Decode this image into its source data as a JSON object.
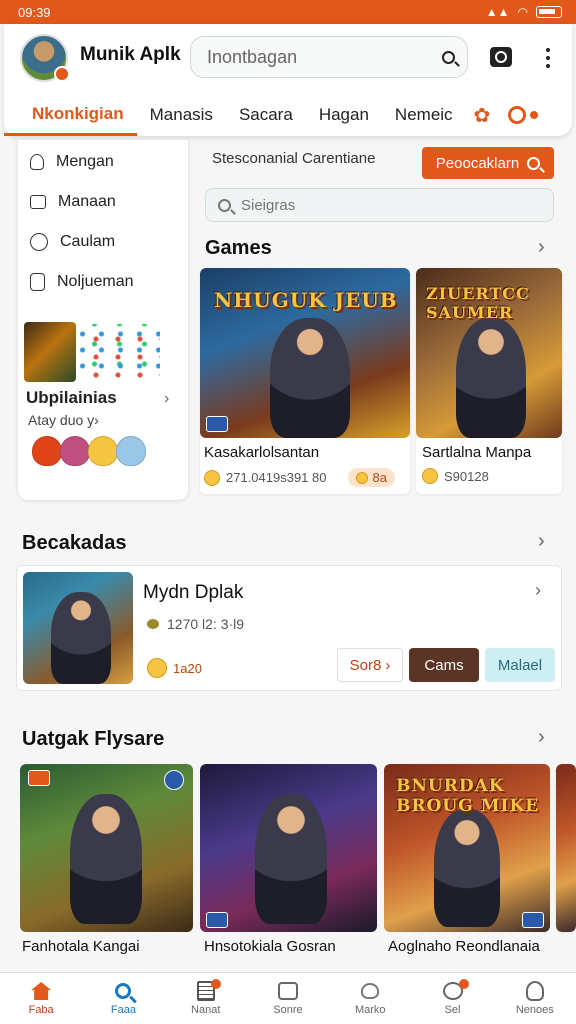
{
  "status_bar": {
    "time": "09:39"
  },
  "header": {
    "app_title": "Munik Aplk",
    "search_placeholder": "Inontbagan",
    "tabs": [
      {
        "label": "Nkonkigian",
        "active": true
      },
      {
        "label": "Manasis"
      },
      {
        "label": "Sacara"
      },
      {
        "label": "Hagan"
      },
      {
        "label": "Nemeic"
      }
    ]
  },
  "sidebar": {
    "items": [
      {
        "label": "Mengan",
        "icon": "person-icon"
      },
      {
        "label": "Manaan",
        "icon": "bag-icon"
      },
      {
        "label": "Caulam",
        "icon": "info-circle-icon"
      },
      {
        "label": "Noljueman",
        "icon": "phone-icon"
      }
    ],
    "promo": {
      "title": "Ubpilainias",
      "subtitle": "Atay duo y›"
    }
  },
  "content": {
    "header_text": "Stesconanial Carentiane",
    "promo_button": "Peoocaklarn",
    "search_placeholder": "Sieigras"
  },
  "games_section": {
    "title": "Games",
    "cards": [
      {
        "name": "Kasakarlolsantan",
        "meta": "271.0419s391 80",
        "pill": "8a",
        "logo": "NHUGUK JEUB"
      },
      {
        "name": "Sartlalna Manpa",
        "meta": "S90128",
        "logo": "ZIUERTCC SAUMER"
      }
    ]
  },
  "becakadas_section": {
    "title": "Becakadas",
    "item": {
      "title": "Mydn Dplak",
      "meta": "1270 l2: 3·l9",
      "rating": "1a20",
      "btn_outline": "Sor8",
      "btn_dark": "Cams",
      "btn_light": "Malael"
    }
  },
  "uatgak_section": {
    "title": "Uatgak Flysare",
    "cards": [
      {
        "name": "Fanhotala Kangai"
      },
      {
        "name": "Hnsotokiala Gosran"
      },
      {
        "name": "Aoglnaho Reondlanaia",
        "logo": "BNURDAK BROUG MIKE"
      }
    ]
  },
  "bottom_nav": [
    {
      "label": "Faba",
      "icon": "home-icon"
    },
    {
      "label": "Faaa",
      "icon": "search-icon"
    },
    {
      "label": "Nanat",
      "icon": "document-icon"
    },
    {
      "label": "Sonre",
      "icon": "chat-check-icon"
    },
    {
      "label": "Marko",
      "icon": "heart-icon"
    },
    {
      "label": "Sel",
      "icon": "sel-icon"
    },
    {
      "label": "Nenoes",
      "icon": "user-icon"
    }
  ],
  "colors": {
    "accent": "#e2581a",
    "search_blue": "#1a7ac0",
    "dark_button": "#5a3424",
    "light_button": "#cdeef2"
  }
}
